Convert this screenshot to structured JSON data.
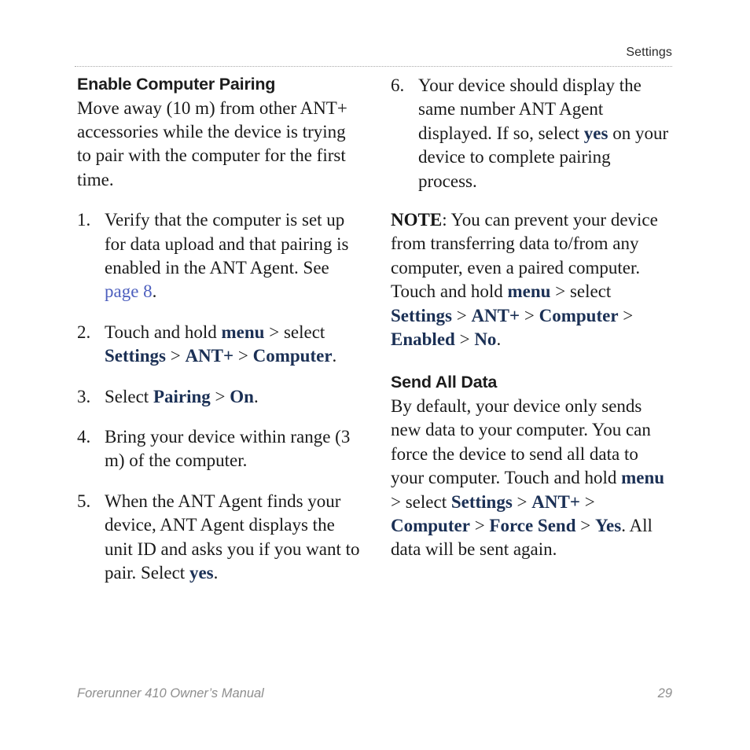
{
  "header": {
    "chapter": "Settings"
  },
  "left_column": {
    "heading": "Enable Computer Pairing",
    "intro": "Move away (10 m) from other ANT+ accessories while the device is trying to pair with the computer for the first time.",
    "steps": [
      {
        "number": "1.",
        "parts": [
          {
            "type": "text",
            "value": "Verify that the computer is set up for data upload and that pairing is enabled in the ANT Agent. See "
          },
          {
            "type": "xref",
            "value": "page 8"
          },
          {
            "type": "text",
            "value": "."
          }
        ]
      },
      {
        "number": "2.",
        "parts": [
          {
            "type": "text",
            "value": "Touch and hold "
          },
          {
            "type": "ui",
            "value": "menu"
          },
          {
            "type": "text",
            "value": " > select "
          },
          {
            "type": "ui",
            "value": "Settings"
          },
          {
            "type": "text",
            "value": " > "
          },
          {
            "type": "ui",
            "value": "ANT+"
          },
          {
            "type": "text",
            "value": " > "
          },
          {
            "type": "ui",
            "value": "Computer"
          },
          {
            "type": "text",
            "value": "."
          }
        ]
      },
      {
        "number": "3.",
        "parts": [
          {
            "type": "text",
            "value": "Select "
          },
          {
            "type": "ui",
            "value": "Pairing"
          },
          {
            "type": "text",
            "value": " > "
          },
          {
            "type": "ui",
            "value": "On"
          },
          {
            "type": "text",
            "value": "."
          }
        ]
      },
      {
        "number": "4.",
        "parts": [
          {
            "type": "text",
            "value": "Bring your device within range (3 m) of the computer."
          }
        ]
      },
      {
        "number": "5.",
        "parts": [
          {
            "type": "text",
            "value": "When the ANT Agent finds your device, ANT Agent displays the unit ID and asks you if you want to pair. Select "
          },
          {
            "type": "ui",
            "value": "yes"
          },
          {
            "type": "text",
            "value": "."
          }
        ]
      }
    ]
  },
  "right_column": {
    "steps": [
      {
        "number": "6.",
        "parts": [
          {
            "type": "text",
            "value": "Your device should display the same number ANT Agent displayed. If so, select "
          },
          {
            "type": "ui",
            "value": "yes"
          },
          {
            "type": "text",
            "value": " on your device to complete pairing process."
          }
        ]
      }
    ],
    "note": {
      "parts": [
        {
          "type": "strong",
          "value": "NOTE"
        },
        {
          "type": "text",
          "value": ": You can prevent your device from transferring data to/from any computer, even a paired computer. Touch and hold "
        },
        {
          "type": "ui",
          "value": "menu"
        },
        {
          "type": "text",
          "value": " > select "
        },
        {
          "type": "ui",
          "value": "Settings"
        },
        {
          "type": "text",
          "value": " > "
        },
        {
          "type": "ui",
          "value": "ANT+"
        },
        {
          "type": "text",
          "value": " > "
        },
        {
          "type": "ui",
          "value": "Computer"
        },
        {
          "type": "text",
          "value": " > "
        },
        {
          "type": "ui",
          "value": "Enabled"
        },
        {
          "type": "text",
          "value": " > "
        },
        {
          "type": "ui",
          "value": "No"
        },
        {
          "type": "text",
          "value": "."
        }
      ]
    },
    "section": {
      "heading": "Send All Data",
      "parts": [
        {
          "type": "text",
          "value": "By default, your device only sends new data to your computer. You can force the device to send all data to your computer. Touch and hold "
        },
        {
          "type": "ui",
          "value": "menu"
        },
        {
          "type": "text",
          "value": " > select "
        },
        {
          "type": "ui",
          "value": "Settings"
        },
        {
          "type": "text",
          "value": " > "
        },
        {
          "type": "ui",
          "value": "ANT+"
        },
        {
          "type": "text",
          "value": " > "
        },
        {
          "type": "ui",
          "value": "Computer"
        },
        {
          "type": "text",
          "value": " > "
        },
        {
          "type": "ui",
          "value": "Force Send"
        },
        {
          "type": "text",
          "value": " > "
        },
        {
          "type": "ui",
          "value": "Yes"
        },
        {
          "type": "text",
          "value": ". All data will be sent again."
        }
      ]
    }
  },
  "footer": {
    "manual_title": "Forerunner 410 Owner’s Manual",
    "page_number": "29"
  },
  "colors": {
    "ui_term": "#1b3055",
    "cross_reference": "#4d5fbe",
    "body_text": "#1a1a1a",
    "footer_text": "#8e8e8e",
    "rule": "#a8a8a8"
  }
}
